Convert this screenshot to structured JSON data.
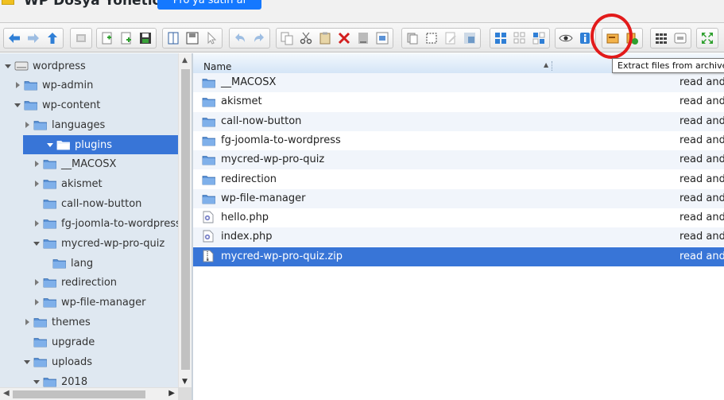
{
  "header": {
    "app_title": "WP Dosya Yöneticisi",
    "pro_button_label": "Pro'ya satın al"
  },
  "toolbar": {
    "groups": [
      [
        "back-icon",
        "forward-icon",
        "up-icon"
      ],
      [
        "reload-icon"
      ],
      [
        "new-folder-icon",
        "new-file-icon",
        "save-icon"
      ],
      [
        "open-icon",
        "download-icon",
        "select-icon"
      ],
      [
        "undo-icon",
        "redo-icon"
      ],
      [
        "copy-icon",
        "cut-icon",
        "paste-icon",
        "delete-icon",
        "empty-icon",
        "rename-icon"
      ],
      [
        "duplicate-icon",
        "select-all-icon",
        "edit-icon",
        "resize-icon"
      ],
      [
        "view-icons-icon",
        "view-small-icon",
        "view-list-icon"
      ],
      [
        "preview-icon",
        "info-icon"
      ],
      [
        "extract-icon",
        "archive-icon"
      ],
      [
        "columns-icon",
        "sort-icon"
      ],
      [
        "fullscreen-icon"
      ]
    ]
  },
  "tooltip": {
    "text": "Extract files from archive"
  },
  "tree": {
    "items": [
      {
        "label": "wordpress",
        "depth": 0,
        "caret": "down",
        "icon": "drive"
      },
      {
        "label": "wp-admin",
        "depth": 1,
        "caret": "right",
        "icon": "folder"
      },
      {
        "label": "wp-content",
        "depth": 1,
        "caret": "down",
        "icon": "folder"
      },
      {
        "label": "languages",
        "depth": 2,
        "caret": "right",
        "icon": "folder"
      },
      {
        "label": "plugins",
        "depth": 2,
        "caret": "down",
        "icon": "folder-open",
        "selected": true
      },
      {
        "label": "__MACOSX",
        "depth": 3,
        "caret": "right",
        "icon": "folder"
      },
      {
        "label": "akismet",
        "depth": 3,
        "caret": "right",
        "icon": "folder"
      },
      {
        "label": "call-now-button",
        "depth": 3,
        "caret": "none",
        "icon": "folder"
      },
      {
        "label": "fg-joomla-to-wordpress",
        "depth": 3,
        "caret": "right",
        "icon": "folder"
      },
      {
        "label": "mycred-wp-pro-quiz",
        "depth": 3,
        "caret": "down",
        "icon": "folder"
      },
      {
        "label": "lang",
        "depth": 4,
        "caret": "none",
        "icon": "folder"
      },
      {
        "label": "redirection",
        "depth": 3,
        "caret": "right",
        "icon": "folder"
      },
      {
        "label": "wp-file-manager",
        "depth": 3,
        "caret": "right",
        "icon": "folder"
      },
      {
        "label": "themes",
        "depth": 2,
        "caret": "right",
        "icon": "folder"
      },
      {
        "label": "upgrade",
        "depth": 2,
        "caret": "none",
        "icon": "folder"
      },
      {
        "label": "uploads",
        "depth": 2,
        "caret": "down",
        "icon": "folder"
      },
      {
        "label": "2018",
        "depth": 3,
        "caret": "down",
        "icon": "folder"
      }
    ]
  },
  "list": {
    "column_name": "Name",
    "rows": [
      {
        "name": "__MACOSX",
        "type": "folder",
        "perm": "read and"
      },
      {
        "name": "akismet",
        "type": "folder",
        "perm": "read and"
      },
      {
        "name": "call-now-button",
        "type": "folder",
        "perm": "read and"
      },
      {
        "name": "fg-joomla-to-wordpress",
        "type": "folder",
        "perm": "read and"
      },
      {
        "name": "mycred-wp-pro-quiz",
        "type": "folder",
        "perm": "read and"
      },
      {
        "name": "redirection",
        "type": "folder",
        "perm": "read and"
      },
      {
        "name": "wp-file-manager",
        "type": "folder",
        "perm": "read and"
      },
      {
        "name": "hello.php",
        "type": "php",
        "perm": "read and"
      },
      {
        "name": "index.php",
        "type": "php",
        "perm": "read and"
      },
      {
        "name": "mycred-wp-pro-quiz.zip",
        "type": "zip",
        "perm": "read and",
        "selected": true
      }
    ]
  },
  "colors": {
    "selection": "#3875d7",
    "tree_bg": "#dfe8f1",
    "folder": "#5b92d6",
    "annotation": "#e21b1b"
  }
}
